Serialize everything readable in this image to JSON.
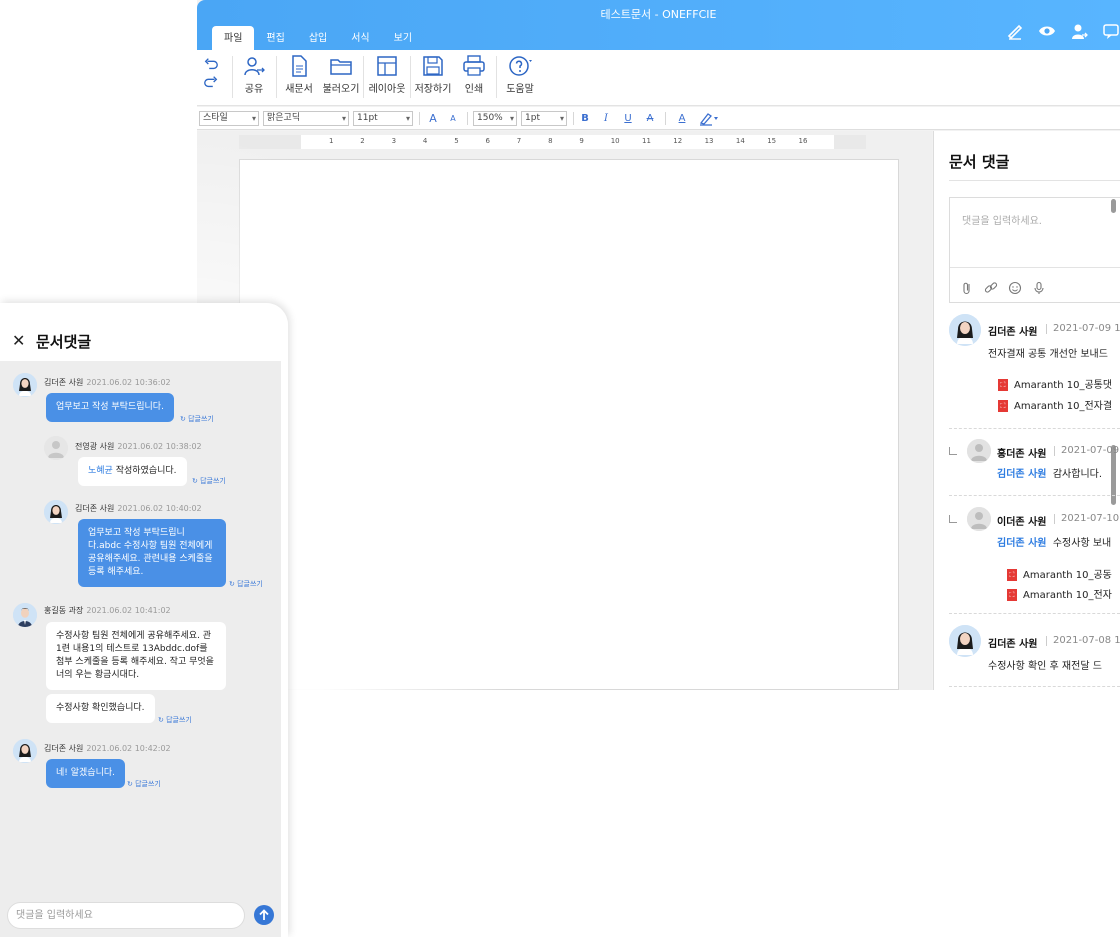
{
  "window": {
    "title": "테스트문서 - ONEFFCIE",
    "tabs": [
      "파일",
      "편집",
      "삽입",
      "서식",
      "보기"
    ]
  },
  "ribbon": {
    "share": "공유",
    "new_doc": "새문서",
    "open": "불러오기",
    "layout": "레이아웃",
    "save": "저장하기",
    "print": "인쇄",
    "help": "도움말"
  },
  "format_bar": {
    "style": "스타일",
    "font": "맑은고딕",
    "size": "11pt",
    "zoom": "150%",
    "line": "1pt",
    "bold": "B",
    "italic": "I",
    "underline": "U",
    "strike": "A",
    "font_color": "A",
    "grow": "A",
    "shrink": "A"
  },
  "ruler_ticks": [
    "1",
    "2",
    "3",
    "4",
    "5",
    "6",
    "7",
    "8",
    "9",
    "10",
    "11",
    "12",
    "13",
    "14",
    "15",
    "16"
  ],
  "comments_panel": {
    "title": "문서 댓글",
    "placeholder": "댓글을 입력하세요.",
    "items": [
      {
        "name": "김더존 사원",
        "date": "2021-07-09 1",
        "text": "전자결재 공통 개선안 보내드",
        "attachments": [
          "Amaranth 10_공통댓",
          "Amaranth 10_전자결"
        ]
      },
      {
        "name": "홍더존 사원",
        "date": "2021-07-09",
        "tag": "김더존 사원",
        "text": "감사합니다."
      },
      {
        "name": "이더존 사원",
        "date": "2021-07-10",
        "tag": "김더존 사원",
        "text": "수정사항 보내",
        "attachments": [
          "Amaranth 10_공동",
          "Amaranth 10_전자"
        ]
      },
      {
        "name": "김더존 사원",
        "date": "2021-07-08 1",
        "text": "수정사항 확인 후 재전달 드"
      }
    ]
  },
  "mobile": {
    "title": "문서댓글",
    "input_placeholder": "댓글을 입력하세요",
    "reply_label": "답글쓰기",
    "messages": [
      {
        "name": "김더존 사원",
        "time": "2021.06.02 10:36:02",
        "text": "업무보고 작성 부탁드립니다."
      },
      {
        "name": "전영광 사원",
        "time": "2021.06.02 10:38:02",
        "tag": "노혜균",
        "text": " 작성하였습니다."
      },
      {
        "name": "김더존 사원",
        "time": "2021.06.02 10:40:02",
        "text": "업무보고 작성 부탁드립니다.abdc 수정사항 팀원 전체에게 공유해주세요. 관련내용 스케줄을 등록 해주세요."
      },
      {
        "name": "홍길동 과장",
        "time": "2021.06.02 10:41:02",
        "text": "수정사항 팀원 전체에게 공유해주세요. 관1련 내용1의 테스트로 13Abddc.dof를 첨부 스케줄을 등록 해주세요. 작고 무엇을 너의 우는 황금시대다.",
        "text2": "수정사항 확인했습니다."
      },
      {
        "name": "김더존 사원",
        "time": "2021.06.02 10:42:02",
        "text": "네! 알겠습니다."
      }
    ]
  }
}
